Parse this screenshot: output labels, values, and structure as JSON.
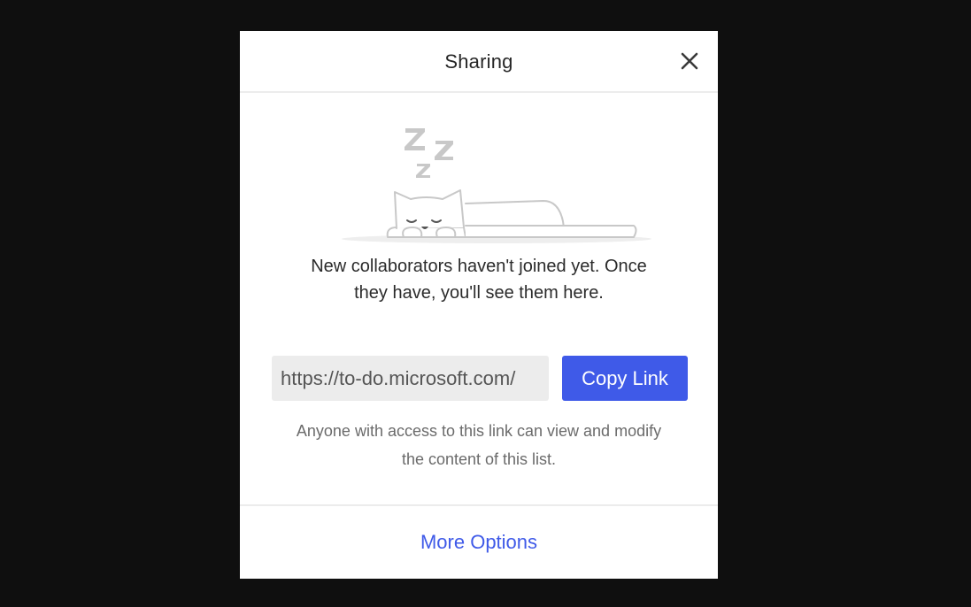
{
  "dialog": {
    "title": "Sharing",
    "close_icon": "close-icon",
    "illustration": "sleeping-cat-illustration",
    "empty_message_line1": "New collaborators haven't joined yet. Once",
    "empty_message_line2": "they have, you'll see them here.",
    "link_value": "https://to-do.microsoft.com/",
    "copy_button_label": "Copy Link",
    "access_note_line1": "Anyone with access to this link can view and modify",
    "access_note_line2": "the content of this list.",
    "more_options_label": "More Options"
  },
  "colors": {
    "backdrop": "#0f0f0f",
    "dialog_background": "#ffffff",
    "accent": "#3f5ae8",
    "field_background": "#ececec",
    "illustration_stroke": "#c8c8c8"
  }
}
